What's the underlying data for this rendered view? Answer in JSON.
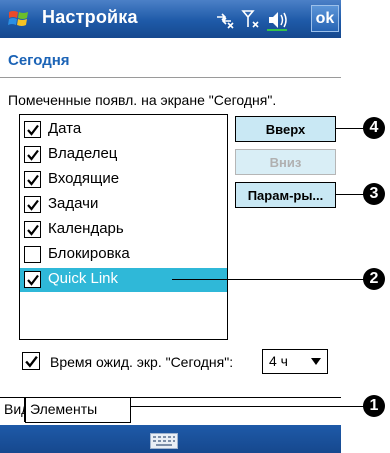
{
  "titlebar": {
    "title": "Настройка",
    "ok_label": "ok"
  },
  "page": {
    "title": "Сегодня",
    "instruction": "Помеченные появл. на экране \"Сегодня\"."
  },
  "list": {
    "items": [
      {
        "label": "Дата",
        "checked": true,
        "selected": false
      },
      {
        "label": "Владелец",
        "checked": true,
        "selected": false
      },
      {
        "label": "Входящие",
        "checked": true,
        "selected": false
      },
      {
        "label": "Задачи",
        "checked": true,
        "selected": false
      },
      {
        "label": "Календарь",
        "checked": true,
        "selected": false
      },
      {
        "label": "Блокировка",
        "checked": false,
        "selected": false
      },
      {
        "label": "Quick Link",
        "checked": true,
        "selected": true
      }
    ]
  },
  "buttons": {
    "up": "Вверх",
    "down": "Вниз",
    "params": "Парам-ры..."
  },
  "timeout": {
    "label": "Время ожид. экр. \"Сегодня\":",
    "checked": true,
    "value": "4 ч"
  },
  "tabs": [
    {
      "label": "Вид",
      "active": false
    },
    {
      "label": "Элементы",
      "active": true
    }
  ],
  "callouts": [
    "4",
    "3",
    "2",
    "1"
  ],
  "icons": {
    "start": "windows-flag-icon",
    "connectivity": "connectivity-icon",
    "signal": "signal-icon",
    "volume": "volume-icon",
    "keyboard": "keyboard-icon",
    "checkmark": "checkmark-icon",
    "dropdown": "chevron-down-icon"
  },
  "colors": {
    "titlebar": "#1e5aa8",
    "page_title": "#1b63b6",
    "selection": "#2fb8d8",
    "button_bg": "#c9e8f4"
  }
}
